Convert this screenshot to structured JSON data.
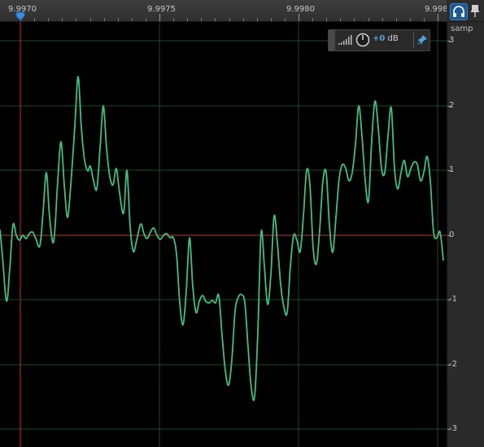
{
  "ruler": {
    "labels": [
      "9.9970",
      "9.9975",
      "9.9980",
      "9.998"
    ]
  },
  "scale": {
    "unit": "samp",
    "labels": [
      "3",
      "2",
      "1",
      "0",
      "-1",
      "-2",
      "-3"
    ]
  },
  "gain_panel": {
    "value": "+0",
    "unit": "dB"
  },
  "colors": {
    "waveform": "#3fbf7f",
    "zero_line": "#b83a3a",
    "cursor": "#c03030",
    "accent": "#1e5a8f"
  },
  "icons": {
    "headphones": "headphones-icon",
    "pin": "pin-icon",
    "meter": "level-meter-icon",
    "knob": "gain-knob-icon",
    "gain_pin": "pin-icon"
  }
}
